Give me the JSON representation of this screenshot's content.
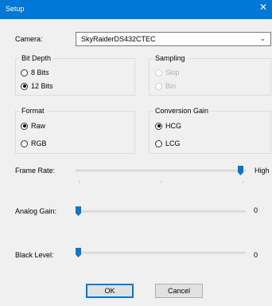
{
  "window": {
    "title": "Setup",
    "close_glyph": "✕"
  },
  "camera": {
    "label": "Camera:",
    "value": "SkyRaiderDS432CTEC"
  },
  "bit_depth": {
    "legend": "Bit Depth",
    "options": [
      "8 Bits",
      "12 Bits"
    ],
    "selected": "12 Bits"
  },
  "sampling": {
    "legend": "Sampling",
    "options": [
      "Skip",
      "Bin"
    ]
  },
  "format": {
    "legend": "Format",
    "options": [
      "Raw",
      "RGB"
    ],
    "selected": "Raw"
  },
  "conversion_gain": {
    "legend": "Conversion Gain",
    "options": [
      "HCG",
      "LCG"
    ],
    "selected": "HCG"
  },
  "frame_rate": {
    "label": "Frame Rate:",
    "value": "High",
    "level": 1.0
  },
  "analog_gain": {
    "label": "Analog Gain:",
    "value": "0",
    "level": 0.0
  },
  "black_level": {
    "label": "Black Level:",
    "value": "0",
    "level": 0.0
  },
  "buttons": {
    "ok": "OK",
    "cancel": "Cancel"
  },
  "colors": {
    "accent": "#0078d7",
    "background": "#f0f0f0"
  }
}
